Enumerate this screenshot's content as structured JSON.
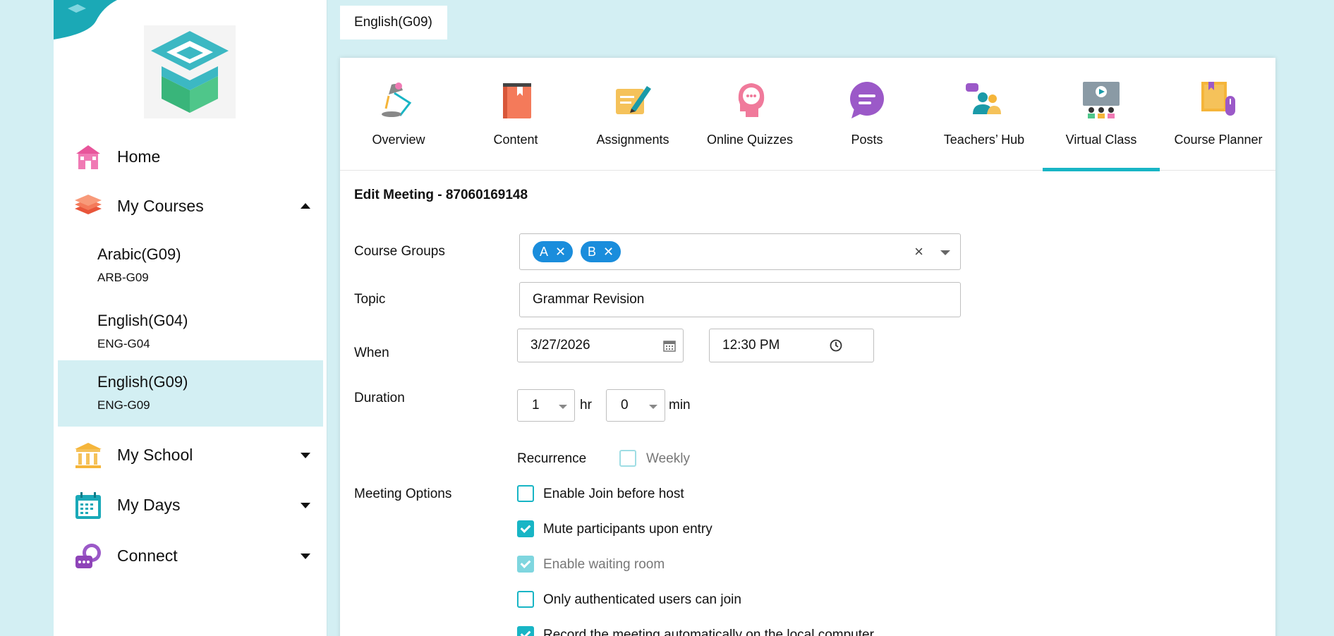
{
  "sidebar": {
    "nav": [
      {
        "label": "Home",
        "icon": "home-icon"
      },
      {
        "label": "My Courses",
        "icon": "books-icon"
      },
      {
        "label": "My School",
        "icon": "school-icon"
      },
      {
        "label": "My Days",
        "icon": "calendar-icon"
      },
      {
        "label": "Connect",
        "icon": "chat-icon"
      }
    ],
    "courses": [
      {
        "name": "Arabic(G09)",
        "code": "ARB-G09"
      },
      {
        "name": "English(G04)",
        "code": "ENG-G04"
      },
      {
        "name": "English(G09)",
        "code": "ENG-G09"
      }
    ]
  },
  "header": {
    "course_chip": "English(G09)"
  },
  "tabs": [
    {
      "label": "Overview",
      "icon": "desk-lamp-icon"
    },
    {
      "label": "Content",
      "icon": "book-icon"
    },
    {
      "label": "Assignments",
      "icon": "pen-paper-icon"
    },
    {
      "label": "Online Quizzes",
      "icon": "thinking-head-icon"
    },
    {
      "label": "Posts",
      "icon": "speech-bubble-icon"
    },
    {
      "label": "Teachers’ Hub",
      "icon": "teachers-icon"
    },
    {
      "label": "Virtual Class",
      "icon": "virtual-class-icon"
    },
    {
      "label": "Course Planner",
      "icon": "planner-icon"
    }
  ],
  "active_tab": "Virtual Class",
  "form": {
    "title": "Edit Meeting - 87060169148",
    "labels": {
      "course_groups": "Course Groups",
      "topic": "Topic",
      "when": "When",
      "duration": "Duration",
      "meeting_options": "Meeting Options",
      "recurrence": "Recurrence"
    },
    "groups": [
      "A",
      "B"
    ],
    "topic_value": "Grammar Revision",
    "date_value": "3/27/2026",
    "time_value": "12:30 PM",
    "duration_hr": "1",
    "duration_min": "0",
    "hr_unit": "hr",
    "min_unit": "min",
    "weekly_label": "Weekly",
    "weekly_checked": false,
    "options": [
      {
        "label": "Enable Join before host",
        "checked": false
      },
      {
        "label": "Mute participants upon entry",
        "checked": true
      },
      {
        "label": "Enable waiting room",
        "checked": true,
        "disabled": true
      },
      {
        "label": "Only authenticated users can join",
        "checked": false
      },
      {
        "label": "Record the meeting automatically on the local computer",
        "checked": true
      }
    ]
  },
  "colors": {
    "background": "#d3eff3",
    "accent": "#18b5c5",
    "tag": "#1a8ddc"
  }
}
